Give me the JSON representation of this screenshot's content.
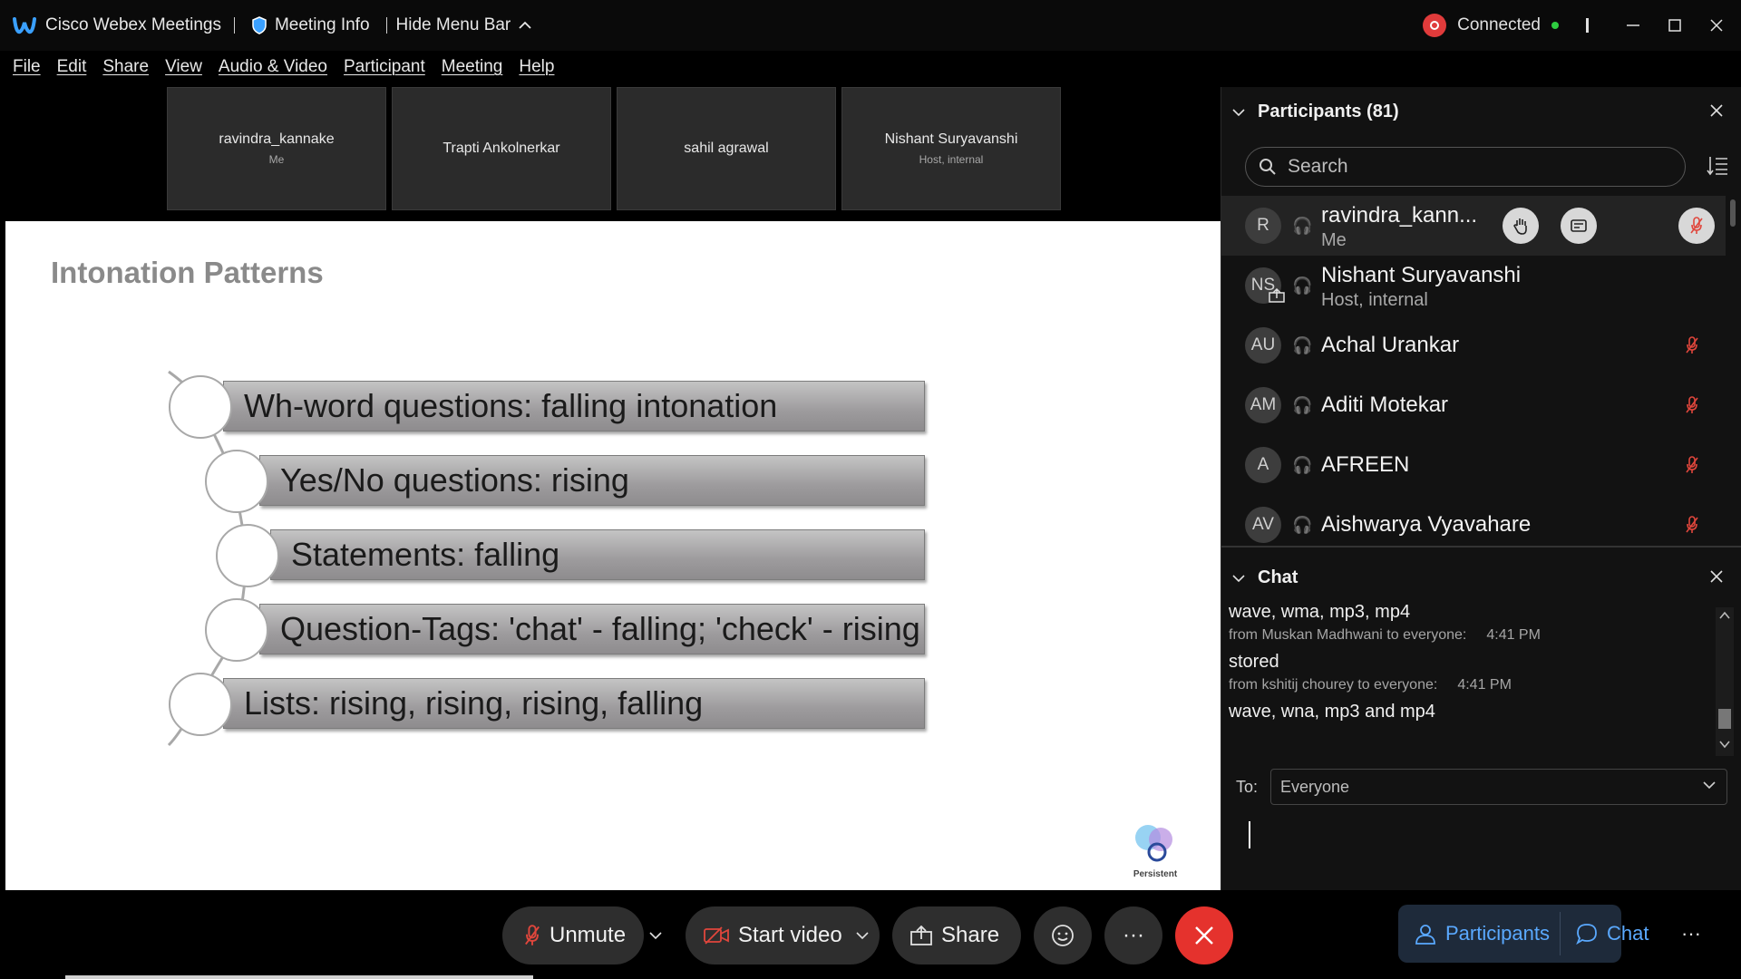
{
  "titlebar": {
    "app_name": "Cisco Webex Meetings",
    "meeting_info": "Meeting Info",
    "hide_menu": "Hide Menu Bar",
    "status": "Connected"
  },
  "menu": [
    "File",
    "Edit",
    "Share",
    "View",
    "Audio & Video",
    "Participant",
    "Meeting",
    "Help"
  ],
  "tiles": [
    {
      "name": "ravindra_kannake",
      "sub": "Me"
    },
    {
      "name": "Trapti Ankolnerkar",
      "sub": ""
    },
    {
      "name": "sahil agrawal",
      "sub": ""
    },
    {
      "name": "Nishant Suryavanshi",
      "sub": "Host, internal"
    }
  ],
  "slide": {
    "title": "Intonation Patterns",
    "items": [
      "Wh-word questions: falling intonation",
      "Yes/No questions: rising",
      "Statements: falling",
      "Question-Tags: 'chat' - falling; 'check' - rising",
      "Lists: rising, rising, rising, falling"
    ],
    "brand": "Persistent"
  },
  "participants": {
    "title": "Participants (81)",
    "search_placeholder": "Search",
    "list": [
      {
        "initials": "R",
        "name": "ravindra_kann...",
        "sub": "Me"
      },
      {
        "initials": "NS",
        "name": "Nishant Suryavanshi",
        "sub": "Host, internal"
      },
      {
        "initials": "AU",
        "name": "Achal Urankar",
        "sub": ""
      },
      {
        "initials": "AM",
        "name": "Aditi Motekar",
        "sub": ""
      },
      {
        "initials": "A",
        "name": "AFREEN",
        "sub": ""
      },
      {
        "initials": "AV",
        "name": "Aishwarya Vyavahare",
        "sub": ""
      }
    ]
  },
  "chat": {
    "title": "Chat",
    "messages": [
      {
        "text": "wave, wma, mp3, mp4"
      },
      {
        "from": "from Muskan Madhwani to everyone:",
        "time": "4:41 PM"
      },
      {
        "text": "stored"
      },
      {
        "from": "from kshitij chourey to everyone:",
        "time": "4:41 PM"
      },
      {
        "text": "wave, wna, mp3 and mp4"
      }
    ],
    "to_label": "To:",
    "to_value": "Everyone"
  },
  "controls": {
    "unmute": "Unmute",
    "start_video": "Start video",
    "share": "Share",
    "participants": "Participants",
    "chat": "Chat"
  },
  "colors": {
    "end_call": "#e5322d",
    "accent_blue": "#5aa9ff",
    "mute_red": "#e0463c",
    "connected_green": "#2ecc40"
  }
}
